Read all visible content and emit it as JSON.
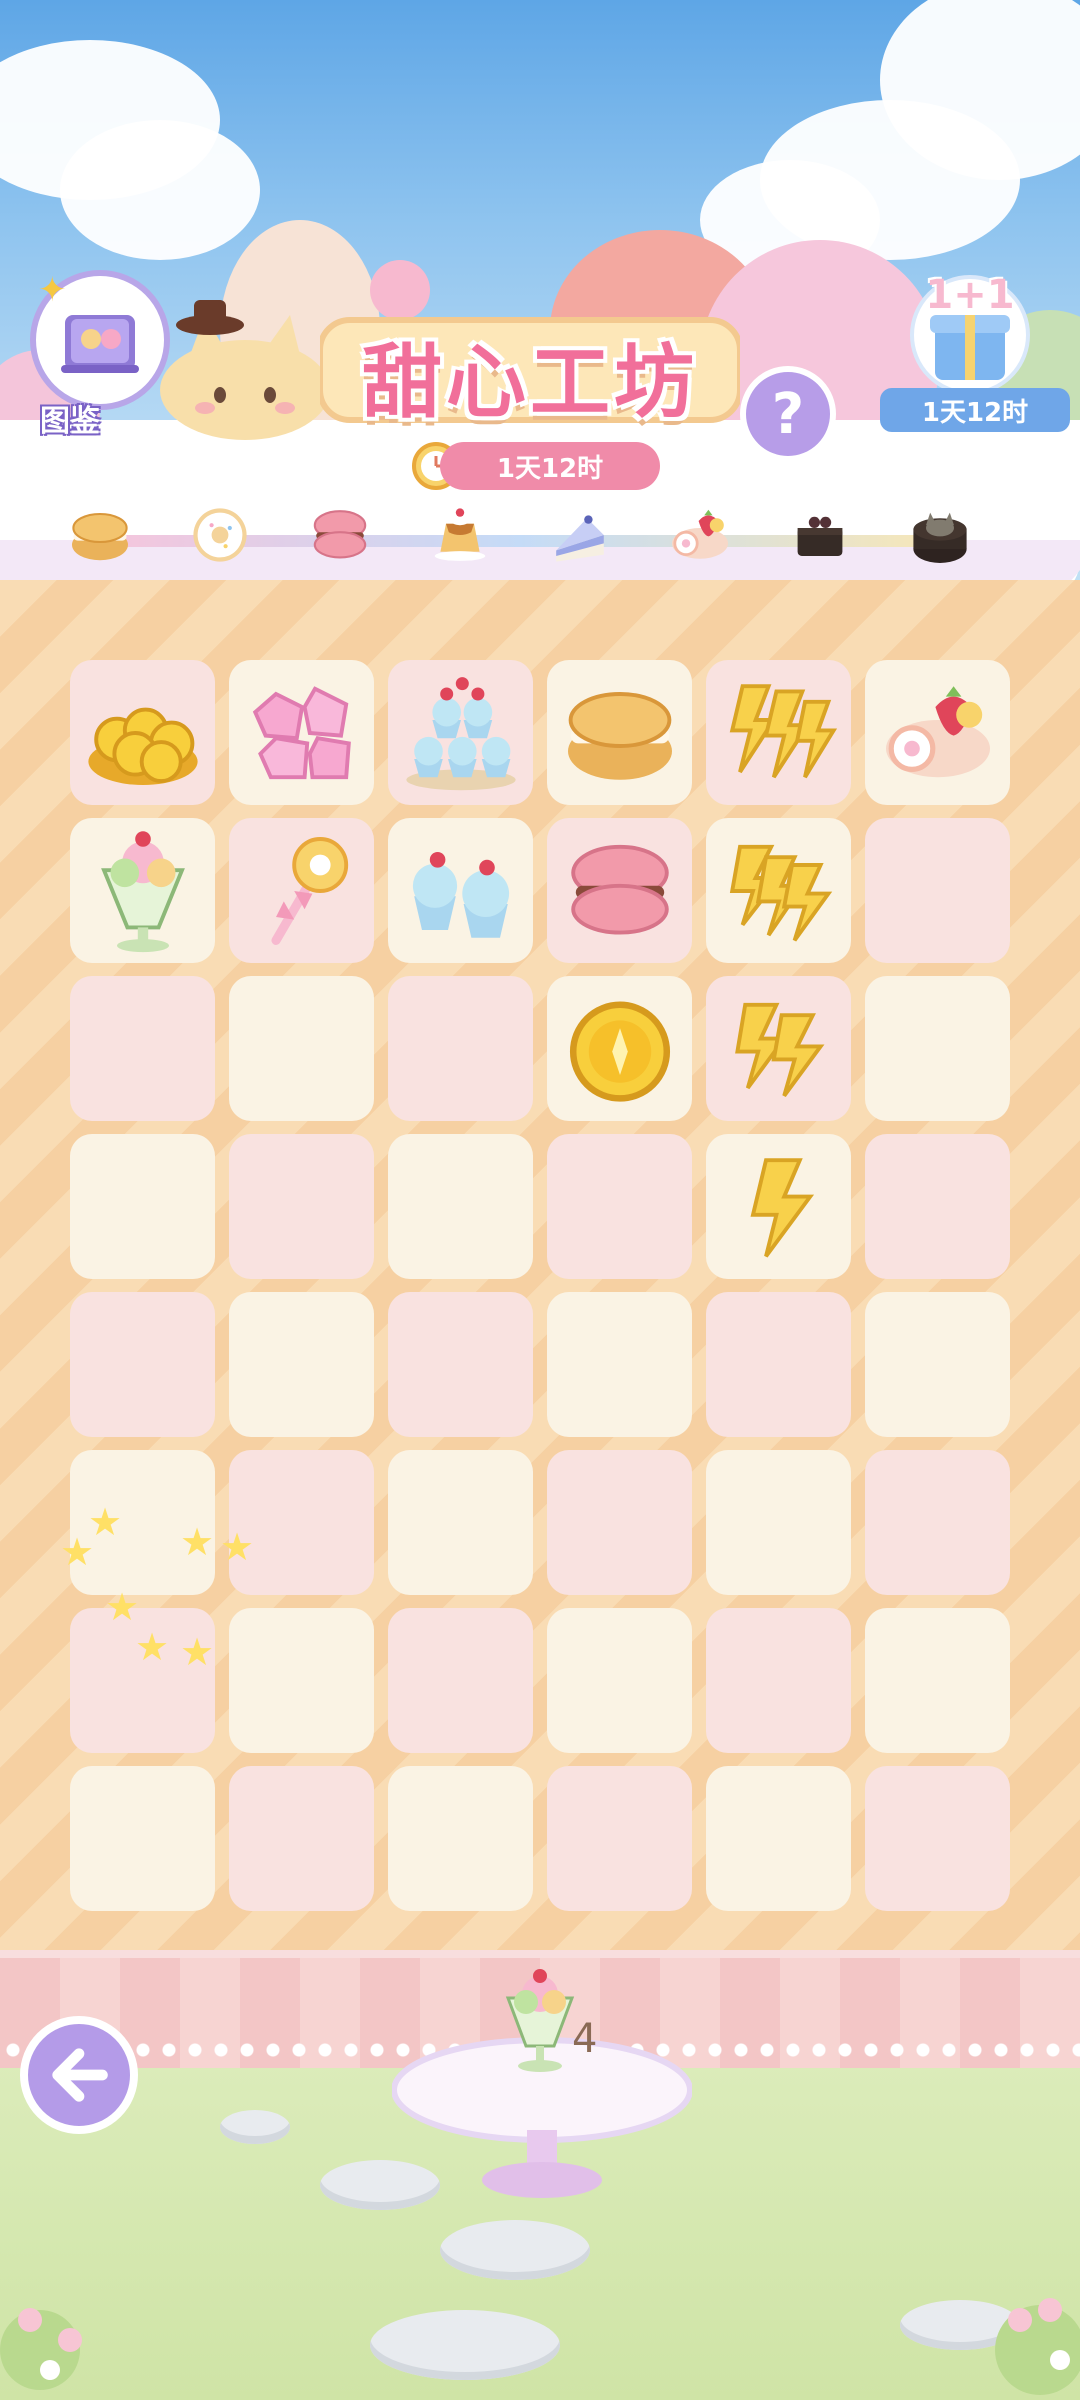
{
  "header": {
    "title": "甜心工坊",
    "event_timer": "1天12时",
    "book_label": "图鉴",
    "help_symbol": "?",
    "gift_badge": "1+1",
    "gift_timer": "1天12时"
  },
  "progress_track": {
    "items": [
      "cream-puff",
      "donut",
      "macaron",
      "pudding",
      "blueberry-cake",
      "strawberry-roll",
      "chocolate-cake",
      "cat-chocolate-cake"
    ],
    "unlocked_count": 6
  },
  "board": {
    "columns": 6,
    "rows": 8,
    "cells": [
      [
        "gold-coins-pile",
        "pink-gems",
        "cupcake-tower",
        "cream-puff",
        "lightning-triple",
        "strawberry-roll"
      ],
      [
        "parfait",
        "lollipop-wand",
        "cupcake-pair",
        "macaron",
        "lightning-stack",
        "empty"
      ],
      [
        "empty",
        "empty",
        "empty",
        "gold-coin",
        "lightning-double",
        "empty"
      ],
      [
        "empty",
        "empty",
        "empty",
        "empty",
        "lightning-single",
        "empty"
      ],
      [
        "empty",
        "empty",
        "empty",
        "empty",
        "empty",
        "empty"
      ],
      [
        "empty",
        "empty",
        "empty",
        "empty",
        "empty",
        "empty"
      ],
      [
        "empty",
        "empty",
        "empty",
        "empty",
        "empty",
        "empty"
      ],
      [
        "empty",
        "empty",
        "empty",
        "empty",
        "empty",
        "empty"
      ]
    ]
  },
  "order": {
    "item": "parfait",
    "count": "4"
  },
  "colors": {
    "title_pink": "#f16f9a",
    "timer_pink": "#f08ba9",
    "button_purple": "#b79de8",
    "gift_blue": "#6fa6e8"
  }
}
